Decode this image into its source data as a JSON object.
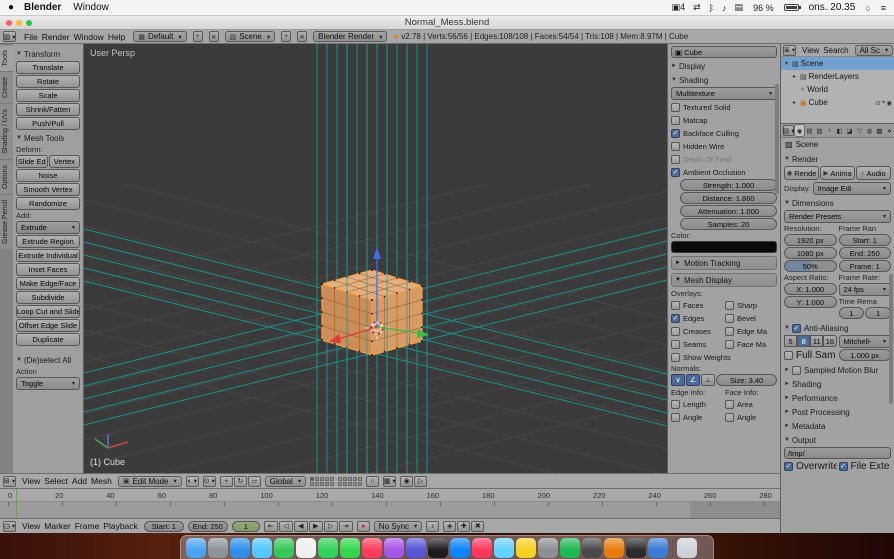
{
  "colors": {
    "accent_orange": "#e87d0d",
    "selection_blue": "#72a0d0",
    "normals_teal": "#15a0a0",
    "viewport_bg": "#3b3b3b"
  },
  "menubar": {
    "apple_icon": "●",
    "app": "Blender",
    "menus": [
      "Window"
    ],
    "status": [
      {
        "n": "app-badge-icon",
        "g": "▣4"
      },
      {
        "n": "airplay-icon",
        "g": "⇄"
      },
      {
        "n": "bluetooth-icon",
        "g": "ᛒ"
      },
      {
        "n": "volume-icon",
        "g": "♪"
      },
      {
        "n": "display-icon",
        "g": "▤"
      }
    ],
    "battery": "96 %",
    "clock": "ons. 20.35",
    "spotlight": "○",
    "notification": "≡"
  },
  "titlebar": {
    "title": "Normal_Mess.blend"
  },
  "info_header": {
    "editor_icon": "▥",
    "menus": [
      "File",
      "Render",
      "Window",
      "Help"
    ],
    "layout_icon": "▦",
    "layout": "Default",
    "add": "+",
    "close": "✕",
    "scene_icon": "▧",
    "scene": "Scene",
    "engine": "Blender Render",
    "logo": "●",
    "stats": "v2.78 | Verts:56/56 | Edges:108/108 | Faces:54/54 | Tris:108 | Mem:8.97M | Cube"
  },
  "toolshelf": {
    "tabs": [
      {
        "label": "Tools",
        "on": true
      },
      {
        "label": "Create"
      },
      {
        "label": "Shading / UVs"
      },
      {
        "label": "Options"
      },
      {
        "label": "Grease Pencil"
      }
    ],
    "transform": {
      "title": "Transform",
      "buttons": [
        "Translate",
        "Rotate",
        "Scale",
        "Shrink/Fatten",
        "Push/Pull"
      ]
    },
    "mesh": {
      "title": "Mesh Tools",
      "deform_label": "Deform:",
      "deform_row": [
        "Slide Ed",
        "Vertex"
      ],
      "deform_buttons": [
        "Noise",
        "Smooth Vertex",
        "Randomize"
      ],
      "add_label": "Add:",
      "extrude": "Extrude",
      "add_buttons": [
        "Extrude Region",
        "Extrude Individual",
        "Inset Faces",
        "Make Edge/Face",
        "Subdivide",
        "Loop Cut and Slide",
        "Offset Edge Slide",
        "Duplicate"
      ]
    },
    "deselect": {
      "title": "(De)select All",
      "action_label": "Action",
      "value": "Toggle"
    }
  },
  "viewport": {
    "persp_label": "User Persp",
    "object_label": "(1) Cube"
  },
  "vheader": {
    "editor_icon": "⊞",
    "menus": [
      "View",
      "Select",
      "Add",
      "Mesh"
    ],
    "mode_icon": "▣",
    "mode": "Edit Mode",
    "shading_icon": "◐",
    "pivot_icon": "⊙",
    "manip": [
      {
        "n": "manipulator-translate-icon",
        "g": "+"
      },
      {
        "n": "manipulator-rotate-icon",
        "g": "↻"
      },
      {
        "n": "manipulator-scale-icon",
        "g": "▱"
      }
    ],
    "orientation": "Global",
    "snap_icon": "∩",
    "snap_el_icon": "▦",
    "render_icons": [
      {
        "n": "render-opengl-icon",
        "g": "◉"
      },
      {
        "n": "render-opengl-anim-icon",
        "g": "▷"
      }
    ]
  },
  "npanel": {
    "item_icon": "▣",
    "item_name": "Cube",
    "display_title": "Display",
    "shading_title": "Shading",
    "shading_mode": "Multitexture",
    "shading_checks": [
      {
        "label": "Textured Solid"
      },
      {
        "label": "Matcap"
      },
      {
        "label": "Backface Culling",
        "on": true
      },
      {
        "label": "Hidden Wire"
      },
      {
        "label": "Depth Of Field",
        "dis": true
      },
      {
        "label": "Ambient Occlusion",
        "on": true
      }
    ],
    "ao_fields": [
      "Strength: 1.000",
      "Distance: 1.860",
      "Attenuation: 1.000",
      "Samples: 20"
    ],
    "color_label": "Color:",
    "motion_title": "Motion Tracking",
    "meshdisp_title": "Mesh Display",
    "overlays_label": "Overlays:",
    "overlay_left": [
      {
        "label": "Faces"
      },
      {
        "label": "Edges",
        "on": true
      },
      {
        "label": "Creases"
      },
      {
        "label": "Seams"
      }
    ],
    "overlay_right": [
      {
        "label": "Sharp"
      },
      {
        "label": "Bevel"
      },
      {
        "label": "Edge Ma"
      },
      {
        "label": "Face Ma"
      }
    ],
    "show_weights": "Show Weights",
    "normals_label": "Normals:",
    "normals_btns": [
      {
        "n": "vertex-normals-icon",
        "g": "∨",
        "on": true
      },
      {
        "n": "loop-normals-icon",
        "g": "∠",
        "on": true
      },
      {
        "n": "face-normals-icon",
        "g": "⊥"
      }
    ],
    "normals_size": "Size: 3.40",
    "edge_info_label": "Edge Info:",
    "face_info_label": "Face Info:",
    "edge_checks": [
      {
        "label": "Length"
      },
      {
        "label": "Angle"
      }
    ],
    "face_checks": [
      {
        "label": "Area"
      },
      {
        "label": "Angle"
      }
    ]
  },
  "outliner": {
    "editor_icon": "≣",
    "menus": [
      "View",
      "Search"
    ],
    "filter": "All Sc",
    "rows": [
      {
        "arrow": "▾",
        "g": "▧",
        "ic": "#333",
        "label": "Scene",
        "sel": true,
        "pad": "2px",
        "noicons": true
      },
      {
        "arrow": "▸",
        "g": "▤",
        "ic": "#333",
        "label": "RenderLayers",
        "pad": "10px",
        "noicons": true
      },
      {
        "arrow": "",
        "g": "♁",
        "ic": "#333",
        "label": "World",
        "pad": "10px",
        "noicons": true
      },
      {
        "arrow": "▸",
        "g": "▣",
        "ic": "#d06c1e",
        "label": "Cube",
        "pad": "10px",
        "ri1": "⊙",
        "ri2": "⌖",
        "ri3": "◉"
      }
    ]
  },
  "properties": {
    "editor_icon": "▤",
    "tabs": [
      {
        "n": "tab-render",
        "g": "◉",
        "on": true
      },
      {
        "n": "tab-render-layers",
        "g": "▤"
      },
      {
        "n": "tab-scene",
        "g": "▧"
      },
      {
        "n": "tab-world",
        "g": "♁"
      },
      {
        "n": "tab-object",
        "g": "◧"
      },
      {
        "n": "tab-modifiers",
        "g": "◪"
      },
      {
        "n": "tab-object-data",
        "g": "▽"
      },
      {
        "n": "tab-material",
        "g": "◍"
      },
      {
        "n": "tab-texture",
        "g": "▩"
      },
      {
        "n": "tab-particles",
        "g": "∗"
      },
      {
        "n": "tab-physics",
        "g": "◌"
      }
    ],
    "breadcrumb_icon": "▧",
    "breadcrumb": "Scene",
    "render": {
      "title": "Render",
      "buttons": [
        {
          "n": "render-button",
          "g": "◉",
          "t": "Rende"
        },
        {
          "n": "render-animation-button",
          "g": "▶",
          "t": "Anima"
        },
        {
          "n": "render-audio-button",
          "g": "♪",
          "t": "Audio"
        }
      ],
      "display_label": "Display:",
      "display_value": "Image Edi"
    },
    "dimensions": {
      "title": "Dimensions",
      "presets": "Render Presets",
      "resolution_label": "Resolution:",
      "frame_range_label": "Frame Ran",
      "fields_left": [
        {
          "t": "1920 px"
        },
        {
          "t": "1080 px"
        },
        {
          "t": "50%",
          "fill": true
        }
      ],
      "fields_right": [
        "Start: 1",
        "End: 250",
        "Frame: 1"
      ],
      "aspect_label": "Aspect Ratio:",
      "aspect_fields": [
        "X: 1.000",
        "Y: 1.000"
      ],
      "frame_rate_label": "Frame Rate:",
      "fps": "24 fps",
      "time_remap_label": "Time Rema",
      "remap_fields": [
        "1",
        "1"
      ]
    },
    "aa": {
      "title": "Anti-Aliasing",
      "box_class": "pbx checked",
      "samples": [
        {
          "t": "5"
        },
        {
          "t": "8",
          "on": true
        },
        {
          "t": "11"
        },
        {
          "t": "16"
        }
      ],
      "filter": "Mitchell-",
      "full_sample": {
        "label": "Full Sam"
      },
      "px": "1.000 px"
    },
    "smb": {
      "title": "Sampled Motion Blur",
      "box_class": "pbx"
    },
    "collapsed": [
      "Shading",
      "Performance",
      "Post Processing",
      "Metadata"
    ],
    "output": {
      "title": "Output",
      "path": "/tmp/",
      "checks": [
        {
          "label": "Overwrite",
          "on": true
        },
        {
          "label": "File Exte",
          "on": true
        }
      ]
    }
  },
  "timeline": {
    "editor_icon": "◷",
    "menus": [
      "View",
      "Marker",
      "Frame",
      "Playback"
    ],
    "ruler": [
      "0",
      "20",
      "40",
      "60",
      "80",
      "100",
      "120",
      "140",
      "160",
      "180",
      "200",
      "220",
      "240",
      "260",
      "280"
    ],
    "start": "Start: 1",
    "end": "End: 250",
    "frame": "1",
    "transport": [
      {
        "n": "jump-to-start-button",
        "g": "⇤"
      },
      {
        "n": "prev-keyframe-button",
        "g": "◁"
      },
      {
        "n": "play-reverse-button",
        "g": "◀"
      },
      {
        "n": "play-button",
        "g": "▶"
      },
      {
        "n": "next-keyframe-button",
        "g": "▷"
      },
      {
        "n": "jump-to-end-button",
        "g": "⇥"
      }
    ],
    "record_icon": "●",
    "sync": "No Sync",
    "speaker_icon": "♪",
    "keys": [
      {
        "n": "keying-set-icon",
        "g": "◈"
      },
      {
        "n": "insert-keyframe-icon",
        "g": "✚"
      },
      {
        "n": "delete-keyframe-icon",
        "g": "✖"
      }
    ]
  },
  "dock": {
    "apps": [
      {
        "n": "dock-finder-icon",
        "c": "#4aa3f0"
      },
      {
        "n": "dock-launchpad-icon",
        "c": "#8e9299"
      },
      {
        "n": "dock-safari-icon",
        "c": "#2e8fe8"
      },
      {
        "n": "dock-mail-icon",
        "c": "#54c7fc"
      },
      {
        "n": "dock-maps-icon",
        "c": "#35c759"
      },
      {
        "n": "dock-photos-icon",
        "c": "#f0f0f2"
      },
      {
        "n": "dock-messages-icon",
        "c": "#30d158"
      },
      {
        "n": "dock-facetime-icon",
        "c": "#32d74b"
      },
      {
        "n": "dock-music-icon",
        "c": "#fc3d5a"
      },
      {
        "n": "dock-podcasts-icon",
        "c": "#a555e8"
      },
      {
        "n": "dock-app-icon",
        "c": "#5856d6"
      },
      {
        "n": "dock-tv-icon",
        "c": "#1d1d1f"
      },
      {
        "n": "dock-appstore-icon",
        "c": "#0a84ff"
      },
      {
        "n": "dock-news-icon",
        "c": "#ff375f"
      },
      {
        "n": "dock-app-icon",
        "c": "#64d2ff"
      },
      {
        "n": "dock-notes-icon",
        "c": "#f5d020"
      },
      {
        "n": "dock-preferences-icon",
        "c": "#8e8e93"
      },
      {
        "n": "dock-spotify-icon",
        "c": "#1db954"
      },
      {
        "n": "dock-app-icon",
        "c": "#4a4a4c"
      },
      {
        "n": "dock-blender-icon",
        "c": "#e87d0d"
      },
      {
        "n": "dock-terminal-icon",
        "c": "#2b2b2d"
      },
      {
        "n": "dock-downloads-icon",
        "c": "#3a7bd5"
      }
    ]
  }
}
